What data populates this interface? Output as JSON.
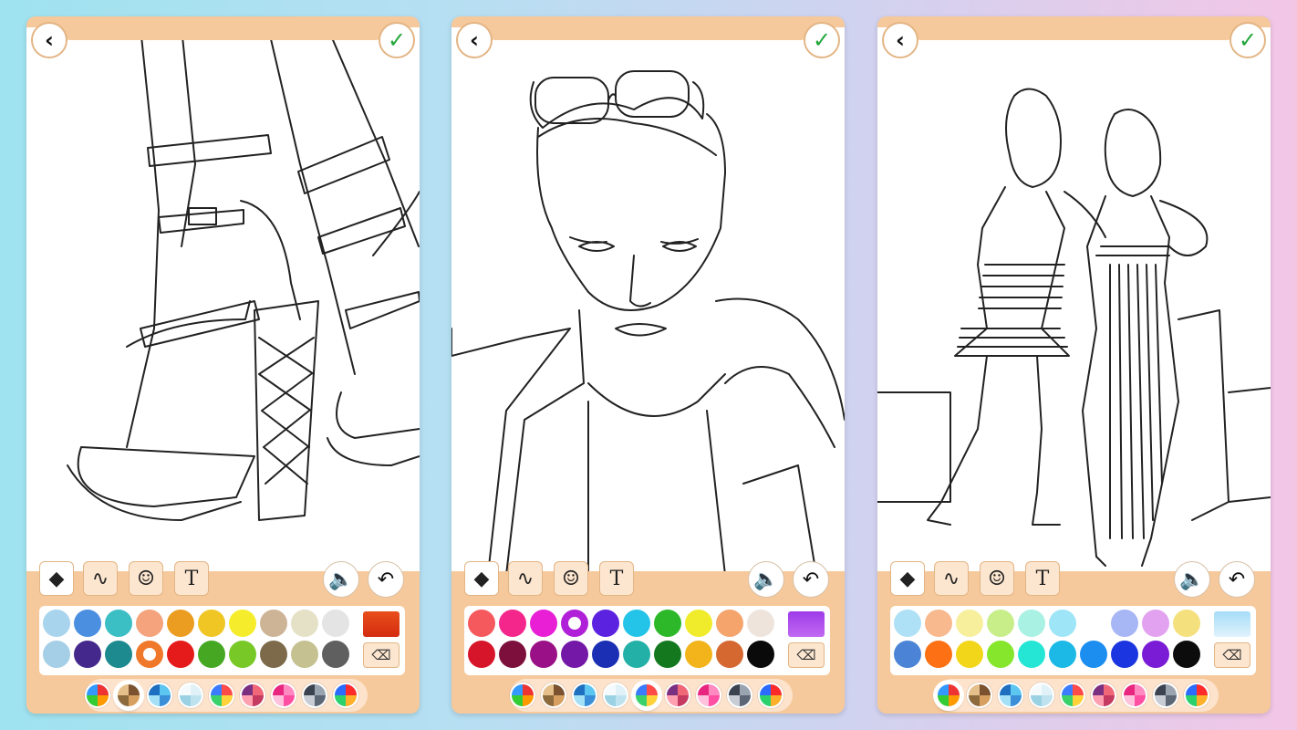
{
  "screens": [
    {
      "name": "shoes",
      "subject": "high-heel-sandals",
      "icons": {
        "back": "chevron-left-icon",
        "done": "checkmark-icon"
      },
      "tools": [
        {
          "icon": "fill-bucket-icon",
          "glyph": "◆",
          "active": true
        },
        {
          "icon": "brush-icon",
          "glyph": "∿",
          "active": false
        },
        {
          "icon": "sticker-icon",
          "glyph": "☺",
          "active": false
        },
        {
          "icon": "text-icon",
          "glyph": "T",
          "active": false
        }
      ],
      "sound_glyph": "🔈",
      "undo_glyph": "↶",
      "palette": [
        "#a8d4ee",
        "#4a8fe0",
        "#3cbfc4",
        "#f5a37c",
        "#eb9d22",
        "#f0c624",
        "#f5ed2c",
        "#cdb497",
        "#e4e1c6",
        "#e4e4e4",
        "#a5cfe6",
        "#45288c",
        "#1d8a8f",
        "#f0782a",
        "#e51b1b",
        "#46a822",
        "#78c928",
        "#7c6a4a",
        "#c6c191",
        "#5f5f5f"
      ],
      "selected_swatch": 13,
      "texture_colors": [
        "#e8501b",
        "#d42b10"
      ],
      "selected_set": 1
    },
    {
      "name": "man",
      "subject": "man-portrait",
      "icons": {
        "back": "chevron-left-icon",
        "done": "checkmark-icon"
      },
      "tools": [
        {
          "icon": "fill-bucket-icon",
          "glyph": "◆",
          "active": true
        },
        {
          "icon": "brush-icon",
          "glyph": "∿",
          "active": false
        },
        {
          "icon": "sticker-icon",
          "glyph": "☺",
          "active": false
        },
        {
          "icon": "text-icon",
          "glyph": "T",
          "active": false
        }
      ],
      "sound_glyph": "🔈",
      "undo_glyph": "↶",
      "palette": [
        "#f5595e",
        "#f4268b",
        "#e81fd4",
        "#b020d8",
        "#5b22e0",
        "#24c4e8",
        "#2db82a",
        "#f0ec2c",
        "#f5a46c",
        "#efe4dc",
        "#d7152a",
        "#7c0f3c",
        "#9a1087",
        "#7418a7",
        "#1a2fb4",
        "#22b0a7",
        "#14781f",
        "#f2b41a",
        "#d46830",
        "#0a0a0a"
      ],
      "selected_swatch": 3,
      "texture_colors": [
        "#9d3ce8",
        "#c169f2"
      ],
      "selected_set": 4
    },
    {
      "name": "women",
      "subject": "two-women-fashion",
      "icons": {
        "back": "chevron-left-icon",
        "done": "checkmark-icon"
      },
      "tools": [
        {
          "icon": "fill-bucket-icon",
          "glyph": "◆",
          "active": true
        },
        {
          "icon": "brush-icon",
          "glyph": "∿",
          "active": false
        },
        {
          "icon": "sticker-icon",
          "glyph": "☺",
          "active": false
        },
        {
          "icon": "text-icon",
          "glyph": "T",
          "active": false
        }
      ],
      "sound_glyph": "🔈",
      "undo_glyph": "↶",
      "palette": [
        "#aee1f5",
        "#f8b98e",
        "#f8ef9c",
        "#c8ee8a",
        "#a9f1e3",
        "#9ee5f7",
        "#ffffff",
        "#a7b6f5",
        "#e3a2f0",
        "#f5e07e",
        "#4b84d6",
        "#fd7114",
        "#f2d61a",
        "#86e62c",
        "#25e6d4",
        "#1cb9e6",
        "#1b8ef0",
        "#1b36e0",
        "#7a1bd6",
        "#0c0c0c"
      ],
      "selected_swatch": 6,
      "texture_colors": [
        "#a6dcf8",
        "#dff3fc"
      ],
      "selected_set": 0
    }
  ],
  "color_sets": [
    [
      "#e33",
      "#f90",
      "#3c3",
      "#39f"
    ],
    [
      "#7a5230",
      "#d8a060",
      "#8c6a3c",
      "#e5c08a"
    ],
    [
      "#5cc6f0",
      "#3a8fd8",
      "#a4e1f6",
      "#1e6fc0"
    ],
    [
      "#e0f2f7",
      "#bfe3ee",
      "#9ad2e4",
      "#f5fbfd"
    ],
    [
      "#ff4a4a",
      "#ffd23a",
      "#3ad16a",
      "#3a7bff"
    ],
    [
      "#f06878",
      "#c53a60",
      "#ffa0b0",
      "#7a2f80"
    ],
    [
      "#ff8ac2",
      "#ff4fa3",
      "#ffc1dc",
      "#e8257f"
    ],
    [
      "#9aa3b0",
      "#5d6675",
      "#c8cdd5",
      "#3b4350"
    ],
    [
      "#ff2b2b",
      "#ffb02b",
      "#2bd16b",
      "#2b6bff"
    ]
  ]
}
